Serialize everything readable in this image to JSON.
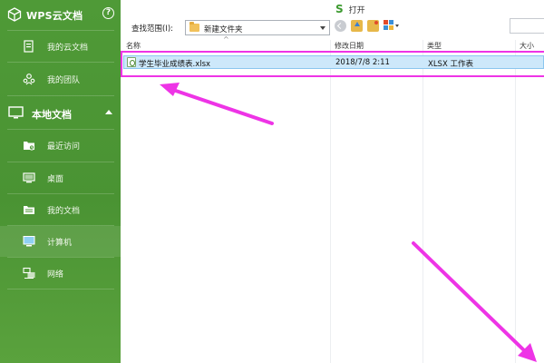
{
  "sidebar": {
    "title": "WPS云文档",
    "help_glyph": "?",
    "items": [
      {
        "label": "我的云文档",
        "icon": "cloud-doc-icon"
      },
      {
        "label": "我的团队",
        "icon": "team-icon"
      }
    ],
    "section": {
      "label": "本地文档",
      "icon": "monitor-icon"
    },
    "local_items": [
      {
        "label": "最近访问",
        "icon": "recent-folder-icon"
      },
      {
        "label": "桌面",
        "icon": "desktop-icon"
      },
      {
        "label": "我的文档",
        "icon": "documents-folder-icon"
      },
      {
        "label": "计算机",
        "icon": "computer-icon"
      },
      {
        "label": "网络",
        "icon": "network-icon"
      }
    ],
    "colors": {
      "background": "#4e9836",
      "text": "#ffffff"
    }
  },
  "toolbar": {
    "open_label": "打开",
    "open_icon_glyph": "S"
  },
  "lookin": {
    "label": "查找范围(I):",
    "value": "新建文件夹"
  },
  "columns": {
    "name": "名称",
    "modified": "修改日期",
    "type": "类型",
    "size": "大小"
  },
  "files": [
    {
      "name": "学生毕业成绩表.xlsx",
      "modified": "2018/7/8 2:11",
      "type": "XLSX 工作表"
    }
  ],
  "annotation": {
    "color": "#ee34e6"
  }
}
